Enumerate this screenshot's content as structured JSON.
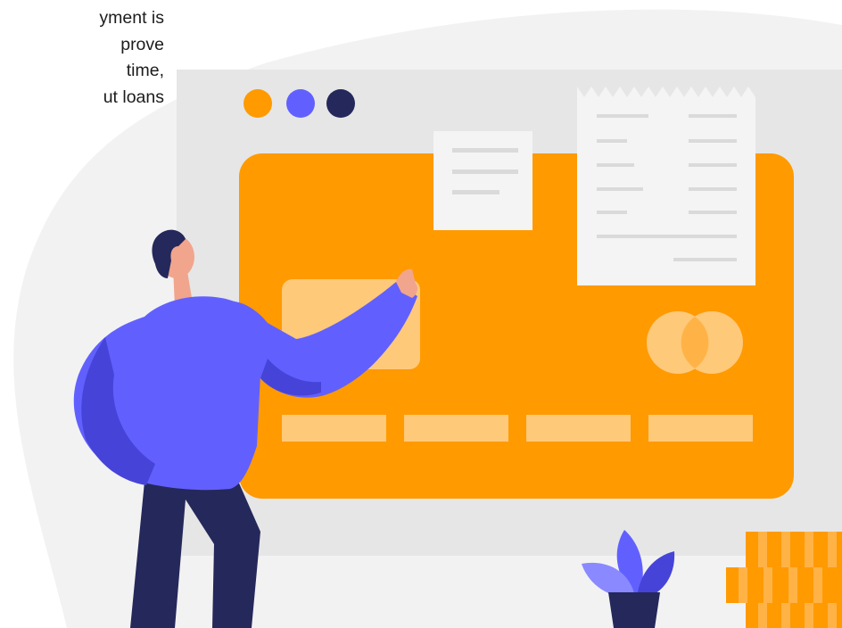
{
  "intro": {
    "lines": [
      "yment is",
      "prove",
      "time,",
      "ut loans"
    ]
  },
  "illustration": {
    "subject": "person-pointing-at-credit-card-payment-screen",
    "icons": [
      "window-dots-icon",
      "card-chip-icon",
      "card-logo-icon",
      "receipt-icon",
      "note-icon",
      "plant-icon",
      "coin-stack-icon"
    ],
    "colors": {
      "accent": "#FF9A00",
      "card_light": "#FFC97A",
      "figure": "#6160FF",
      "figure_dark": "#4644D8",
      "navy": "#24285B",
      "skin": "#F1A58D",
      "background_blob": "#F2F2F2",
      "window": "#E6E6E6",
      "paper": "#F4F4F4"
    }
  }
}
